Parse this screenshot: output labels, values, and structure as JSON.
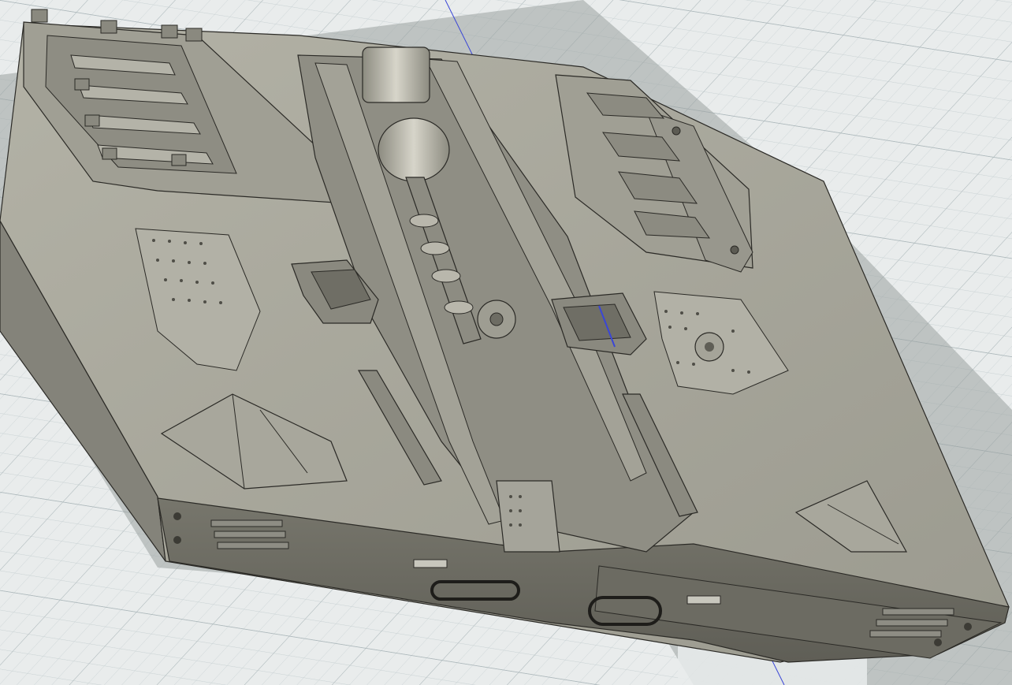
{
  "app": {
    "view": "3d-viewport",
    "camera": "perspective",
    "grid_visible": true,
    "axis_line_visible": true
  },
  "model": {
    "kind": "mechanical-assembly",
    "shading": "shaded-with-visible-edges"
  },
  "colors": {
    "background": "#e9ecec",
    "grid_minor": "#c9d2d4",
    "grid_major": "#aeb9bc",
    "model_top": "#a7a69a",
    "model_side": "#7f7e74",
    "model_front": "#6a6960",
    "edge": "#2b2a26",
    "shadow": "#9da5a3",
    "axis": "#3a46d6"
  }
}
